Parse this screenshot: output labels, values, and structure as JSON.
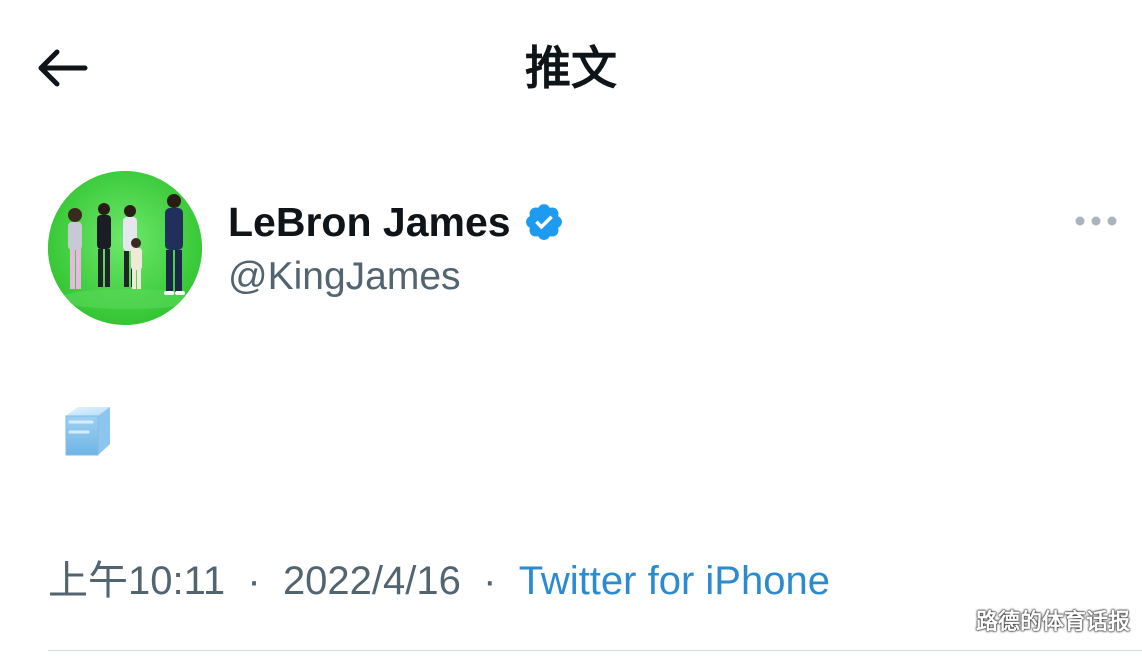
{
  "header": {
    "title": "推文",
    "back_icon": "arrow-left-icon"
  },
  "tweet": {
    "author": {
      "display_name": "LeBron James",
      "handle": "@KingJames",
      "verified": true,
      "verified_color": "#1d9bf0"
    },
    "more_icon": "more-horizontal-icon",
    "body_emoji_name": "ice-cube-emoji",
    "meta": {
      "time": "上午10:11",
      "separator": "·",
      "date": "2022/4/16",
      "source": "Twitter for iPhone"
    }
  },
  "watermark": {
    "text": "路德的体育话报"
  },
  "colors": {
    "text_primary": "#0f1419",
    "text_secondary": "#536471",
    "link": "#2a8bd1",
    "divider": "#cfd9de",
    "avatar_bg": "#3fd13f"
  }
}
